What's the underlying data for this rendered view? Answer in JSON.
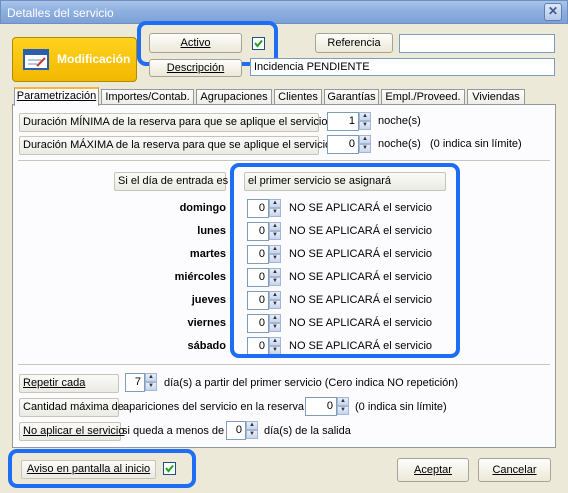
{
  "window": {
    "title": "Detalles del servicio",
    "close_glyph": "✕"
  },
  "header": {
    "mode_label": "Modificación",
    "activo_label": "Activo",
    "activo_checked": true,
    "referencia_label": "Referencia",
    "referencia_value": "",
    "descripcion_label": "Descripción",
    "descripcion_value": "Incidencia PENDIENTE"
  },
  "tabs": [
    {
      "label": "Parametrización",
      "active": true
    },
    {
      "label": "Importes/Contab.",
      "active": false
    },
    {
      "label": "Agrupaciones",
      "active": false
    },
    {
      "label": "Clientes",
      "active": false
    },
    {
      "label": "Garantías",
      "active": false
    },
    {
      "label": "Empl./Proveed.",
      "active": false
    },
    {
      "label": "Viviendas",
      "active": false
    }
  ],
  "duration": {
    "min_label": "Duración MÍNIMA de la reserva para que se aplique el servicio",
    "min_value": "1",
    "min_unit": "noche(s)",
    "max_label": "Duración MÁXIMA de la reserva para que se aplique el servicio",
    "max_value": "0",
    "max_unit": "noche(s)",
    "max_note": "(0 indica sin límite)"
  },
  "schedule": {
    "entry_label": "Si el día de entrada es",
    "first_service_label": "el primer servicio se asignará",
    "days": [
      {
        "name": "domingo",
        "value": "0",
        "text": "NO SE APLICARÁ el servicio"
      },
      {
        "name": "lunes",
        "value": "0",
        "text": "NO SE APLICARÁ el servicio"
      },
      {
        "name": "martes",
        "value": "0",
        "text": "NO SE APLICARÁ el servicio"
      },
      {
        "name": "miércoles",
        "value": "0",
        "text": "NO SE APLICARÁ el servicio"
      },
      {
        "name": "jueves",
        "value": "0",
        "text": "NO SE APLICARÁ el servicio"
      },
      {
        "name": "viernes",
        "value": "0",
        "text": "NO SE APLICARÁ el servicio"
      },
      {
        "name": "sábado",
        "value": "0",
        "text": "NO SE APLICARÁ el servicio"
      }
    ]
  },
  "repeat": {
    "repetir_label": "Repetir cada",
    "repetir_value": "7",
    "repetir_note": "día(s) a partir del primer servicio (Cero indica NO repetición)",
    "max_label": "Cantidad máxima de",
    "max_mid": "apariciones del servicio en la reserva",
    "max_value": "0",
    "max_note": "(0 indica sin límite)",
    "noaplicar_label": "No aplicar el servicio",
    "noaplicar_mid": "si queda a menos de",
    "noaplicar_value": "0",
    "noaplicar_note": "día(s) de la salida"
  },
  "footer": {
    "aviso_label": "Aviso en pantalla al inicio",
    "aviso_checked": true,
    "accept_label": "Aceptar",
    "cancel_label": "Cancelar"
  },
  "colors": {
    "highlight": "#1e6ef5",
    "mode_button": "#f7c200",
    "tab_accent": "#f5b63e"
  }
}
